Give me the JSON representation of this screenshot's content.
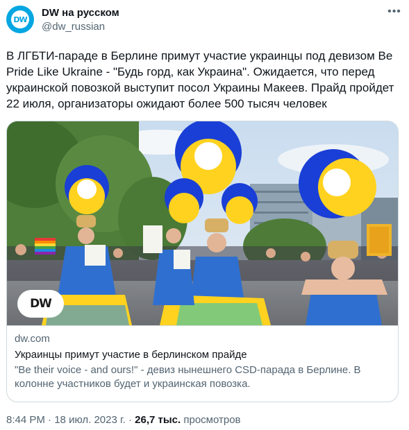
{
  "account": {
    "name": "DW на русском",
    "handle": "@dw_russian",
    "avatar_text": "DW",
    "brand_color": "#05a6e2"
  },
  "more_icon": "more-horizontal-icon",
  "tweet": {
    "text": "В ЛГБТИ-параде в Берлине примут участие украинцы под девизом Be Pride Like Ukraine - \"Будь горд, как Украина\". Ожидается, что перед украинской повозкой выступит посол Украины Макеев. Прайд пройдет 22 июля, организаторы ожидают более 500 тысяч человек"
  },
  "card": {
    "image_logo_text": "DW",
    "domain": "dw.com",
    "title": "Украинцы примут участие в берлинском прайде",
    "description": "\"Be their voice - and ours!\" - девиз нынешнего CSD-парада в Берлине. В колонне участников будет и украинская повозка."
  },
  "meta": {
    "time": "8:44 PM",
    "separator": "·",
    "date": "18 июл. 2023 г.",
    "views_count": "26,7 тыс.",
    "views_label": "просмотров"
  },
  "colors": {
    "text_primary": "#0f1419",
    "text_secondary": "#536471",
    "border": "#cfd9de",
    "flag_blue": "#1a3fd6",
    "flag_yellow": "#ffd21f"
  }
}
